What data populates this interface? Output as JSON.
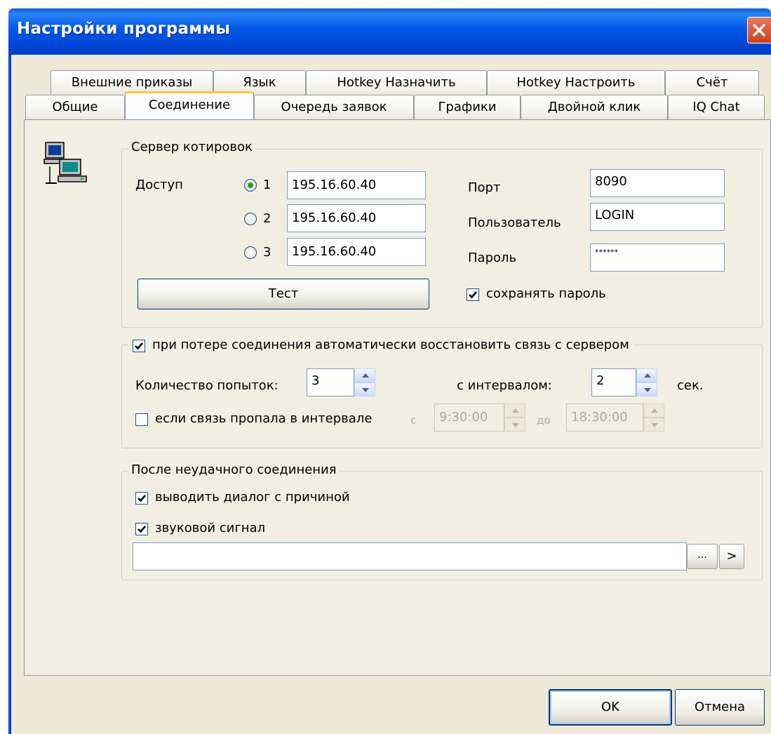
{
  "window": {
    "title": "Настройки программы"
  },
  "tabs": {
    "row1": [
      "Внешние приказы",
      "Язык",
      "Hotkey Назначить",
      "Hotkey Настроить",
      "Счёт"
    ],
    "row2": [
      "Общие",
      "Соединение",
      "Очередь заявок",
      "Графики",
      "Двойной клик",
      "IQ Chat"
    ],
    "active": "Соединение"
  },
  "quote_server": {
    "legend": "Сервер котировок",
    "access_label": "Доступ",
    "servers": [
      {
        "number": "1",
        "address": "195.16.60.40",
        "selected": true
      },
      {
        "number": "2",
        "address": "195.16.60.40",
        "selected": false
      },
      {
        "number": "3",
        "address": "195.16.60.40",
        "selected": false
      }
    ],
    "port_label": "Порт",
    "port_value": "8090",
    "user_label": "Пользователь",
    "user_value": "LOGIN",
    "password_label": "Пароль",
    "password_value": "******",
    "test_button": "Тест",
    "save_password_label": "сохранять пароль",
    "save_password_checked": true
  },
  "reconnect": {
    "legend": "при потере соединения автоматически восстановить связь с сервером",
    "enabled": true,
    "attempts_label": "Количество попыток:",
    "attempts_value": "3",
    "interval_label": "с интервалом:",
    "interval_value": "2",
    "interval_unit": "сек.",
    "time_window_label": "если связь пропала в интервале",
    "time_window_checked": false,
    "from_label": "с",
    "from_value": "9:30:00",
    "to_label": "до",
    "to_value": "18:30:00"
  },
  "after_fail": {
    "legend": "После неудачного соединения",
    "show_dialog_label": "выводить диалог с причиной",
    "show_dialog_checked": true,
    "sound_label": "звуковой сигнал",
    "sound_checked": true,
    "sound_file": "",
    "browse_label": "...",
    "play_label": ">"
  },
  "footer": {
    "ok": "OK",
    "cancel": "Отмена"
  },
  "colors": {
    "titlebar": "#0054e3",
    "dialog_bg": "#ece9d8",
    "tab_highlight": "#ffc83c",
    "close_button": "#d1401c"
  }
}
